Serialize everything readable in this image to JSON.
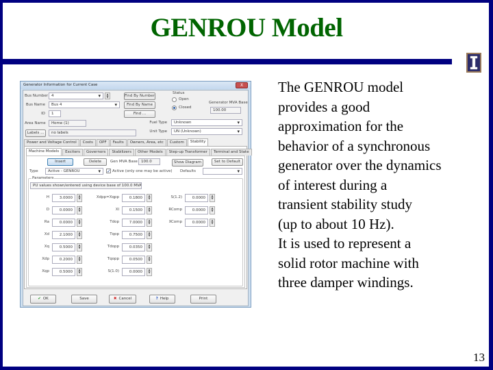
{
  "slide": {
    "title": "GENROU Model",
    "page_number": "13",
    "logo_glyph": "I",
    "body_lines": [
      "The GENROU model",
      "provides a good",
      "approximation for the",
      "behavior of a synchronous",
      "generator over the dynamics",
      "of interest during a",
      "transient stability study",
      "(up to about 10 Hz).",
      "It is used to represent a",
      "solid rotor machine with",
      "three damper windings."
    ],
    "colors": {
      "title": "#006400",
      "frame": "#000080"
    }
  },
  "dialog": {
    "title": "Generator Information for Current Case",
    "close_label": "X",
    "bus_number_label": "Bus Number",
    "bus_number_value": "4",
    "bus_name_label": "Bus Name",
    "bus_name_value": "Bus 4",
    "id_label": "ID",
    "id_value": "1",
    "area_name_label": "Area Name",
    "area_name_value": "Home (1)",
    "labels_button": "Labels ...",
    "labels_value": "no labels",
    "find_by_number": "Find By Number",
    "find_by_name": "Find By Name",
    "find": "Find ...",
    "status_label": "Status",
    "status_open": "Open",
    "status_closed": "Closed",
    "mva_base_label": "Generator MVA Base",
    "mva_base_value": "100.00",
    "fuel_type_label": "Fuel Type",
    "fuel_type_value": "Unknown",
    "unit_type_label": "Unit Type",
    "unit_type_value": "UN (Unknown)",
    "tabs": [
      "Power and Voltage Control",
      "Costs",
      "OPF",
      "Faults",
      "Owners, Area, etc",
      "Custom",
      "Stability"
    ],
    "active_tab": "Stability",
    "subtabs": [
      "Machine Models",
      "Exciters",
      "Governors",
      "Stabilizers",
      "Other Models",
      "Step-up Transformer",
      "Terminal and State"
    ],
    "active_subtab": "Machine Models",
    "insert_button": "Insert",
    "delete_button": "Delete",
    "gen_mva_base_label": "Gen MVA Base",
    "gen_mva_base_value": "100.0",
    "show_diagram_button": "Show Diagram",
    "set_default_button": "Set to Default",
    "type_label": "Type",
    "type_value": "Active - GENROU",
    "active_check_label": "Active (only one may be active)",
    "defaults_label": "Defaults",
    "defaults_value": "",
    "parameters_label": "Parameters",
    "pu_note": "PU values shown/entered using device base of 100.0 MVA",
    "params_col1": [
      {
        "name": "H",
        "value": "3.0000"
      },
      {
        "name": "D",
        "value": "0.0000"
      },
      {
        "name": "Ra",
        "value": "0.0000"
      },
      {
        "name": "Xd",
        "value": "2.1000"
      },
      {
        "name": "Xq",
        "value": "0.5000"
      },
      {
        "name": "Xdp",
        "value": "0.2000"
      },
      {
        "name": "Xqp",
        "value": "0.5000"
      }
    ],
    "params_col2": [
      {
        "name": "Xdpp=Xqpp",
        "value": "0.1800"
      },
      {
        "name": "Xl",
        "value": "0.1500"
      },
      {
        "name": "Tdop",
        "value": "7.0000"
      },
      {
        "name": "Tqop",
        "value": "0.7500"
      },
      {
        "name": "Tdopp",
        "value": "0.0350"
      },
      {
        "name": "Tqopp",
        "value": "0.0500"
      },
      {
        "name": "S(1.0)",
        "value": "0.0000"
      }
    ],
    "params_col3": [
      {
        "name": "S(1.2)",
        "value": "0.0000"
      },
      {
        "name": "RComp",
        "value": "0.0000"
      },
      {
        "name": "XComp",
        "value": "0.0000"
      }
    ],
    "footer": {
      "ok": "OK",
      "save": "Save",
      "cancel": "Cancel",
      "help": "Help",
      "print": "Print"
    }
  }
}
